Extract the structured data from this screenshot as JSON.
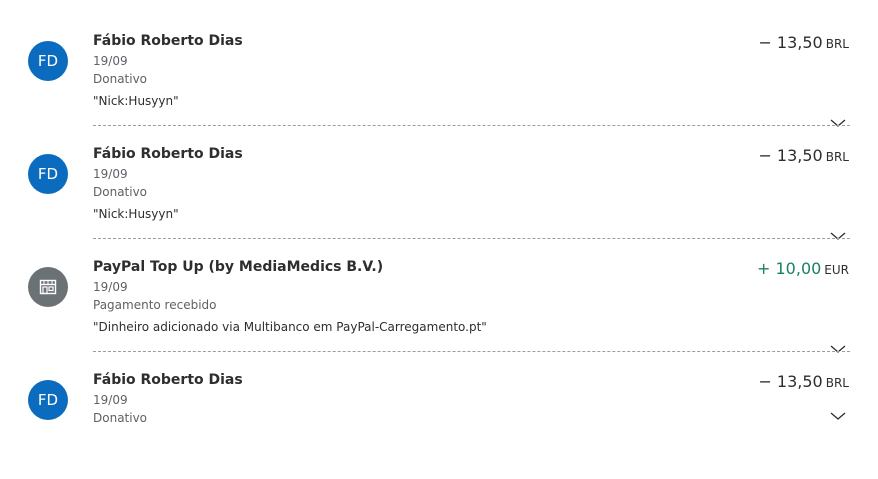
{
  "transactions": [
    {
      "initials": "FD",
      "avatar_type": "initials",
      "name": "Fábio Roberto Dias",
      "date": "19/09",
      "type": "Donativo",
      "note": "\"Nick:Husyyn\"",
      "amount": "− 13,50",
      "currency": "BRL",
      "direction": "negative"
    },
    {
      "initials": "FD",
      "avatar_type": "initials",
      "name": "Fábio Roberto Dias",
      "date": "19/09",
      "type": "Donativo",
      "note": "\"Nick:Husyyn\"",
      "amount": "− 13,50",
      "currency": "BRL",
      "direction": "negative"
    },
    {
      "icon": "storefront-icon",
      "avatar_type": "shop",
      "name": "PayPal Top Up (by MediaMedics B.V.)",
      "date": "19/09",
      "type": "Pagamento recebido",
      "note": "\"Dinheiro adicionado via Multibanco em PayPal-Carregamento.pt\"",
      "amount": "+ 10,00",
      "currency": "EUR",
      "direction": "positive"
    },
    {
      "initials": "FD",
      "avatar_type": "initials",
      "name": "Fábio Roberto Dias",
      "date": "19/09",
      "type": "Donativo",
      "amount": "− 13,50",
      "currency": "BRL",
      "direction": "negative"
    }
  ],
  "colors": {
    "avatar_blue": "#0b6cbf",
    "avatar_gray": "#6b7276",
    "positive_amount": "#1a7f65",
    "divider": "#9a9ea2"
  },
  "icons": {
    "expand": "chevron-down-icon",
    "merchant": "storefront-icon"
  }
}
